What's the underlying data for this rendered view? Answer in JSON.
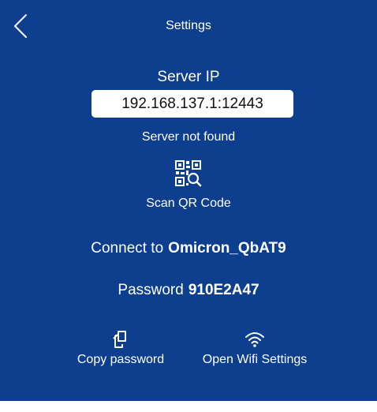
{
  "header": {
    "title": "Settings",
    "back_icon": "chevron-left-icon"
  },
  "server": {
    "label": "Server IP",
    "ip_value": "192.168.137.1:12443",
    "status": "Server not found"
  },
  "scan": {
    "icon": "qr-scan-icon",
    "label": "Scan QR Code"
  },
  "connection": {
    "connect_label": "Connect to",
    "ssid": "Omicron_QbAT9",
    "password_label": "Password",
    "password": "910E2A47"
  },
  "actions": {
    "copy_icon": "copy-icon",
    "copy_label": "Copy password",
    "wifi_icon": "wifi-icon",
    "wifi_label": "Open Wifi Settings"
  },
  "colors": {
    "background": "#0e3f8f",
    "text": "#ffffff",
    "input_background": "#ffffff"
  }
}
